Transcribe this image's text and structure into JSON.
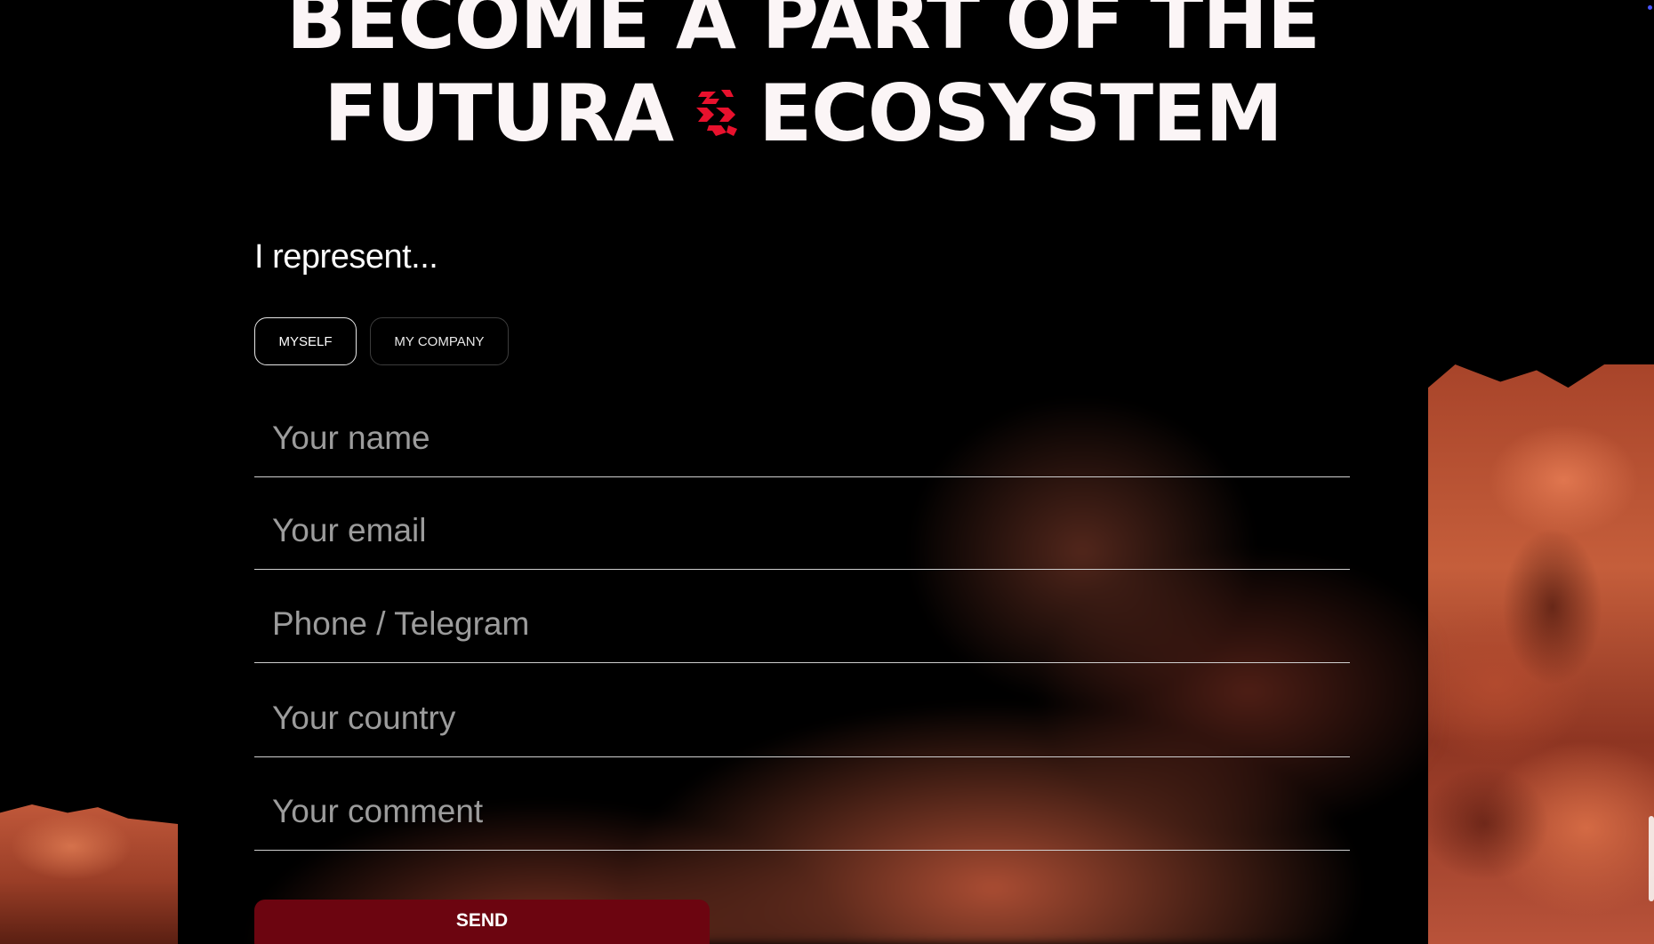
{
  "headline": {
    "line1": "BECOME A PART OF THE",
    "line2_before": "FUTURA",
    "line2_after": "ECOSYSTEM",
    "brand_icon": "futura-logo-icon",
    "brand_color": "#e8112d"
  },
  "form": {
    "represent_label": "I represent...",
    "toggle_options": [
      "MYSELF",
      "MY COMPANY"
    ],
    "selected_option": "MYSELF",
    "fields": {
      "name_placeholder": "Your name",
      "email_placeholder": "Your email",
      "phone_placeholder": "Phone / Telegram",
      "country_placeholder": "Your country",
      "comment_placeholder": "Your comment"
    },
    "send_label": "SEND",
    "send_color": "#6c0510"
  }
}
